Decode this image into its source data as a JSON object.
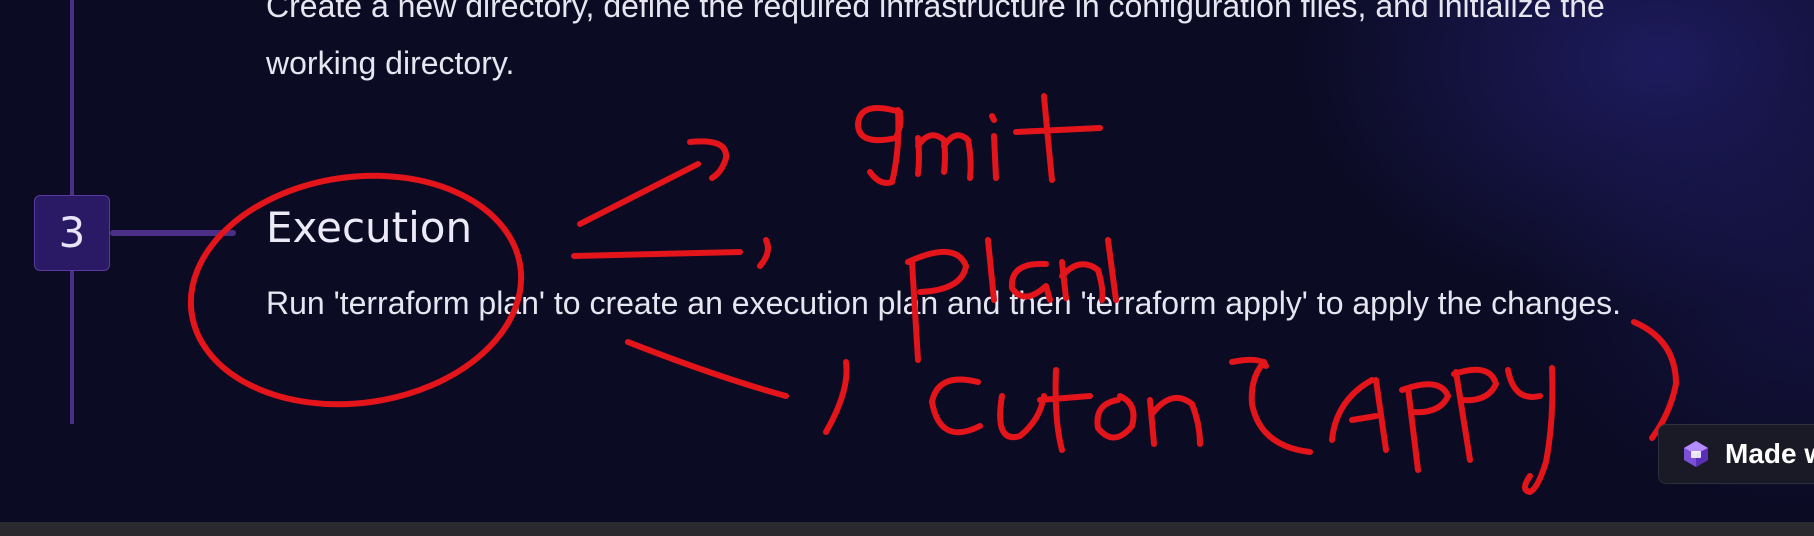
{
  "timeline": {
    "previous_step": {
      "description": "Create a new directory, define the required infrastructure in configuration files, and initialize the working directory."
    },
    "current_step": {
      "number": "3",
      "title": "Execution",
      "description": "Run 'terraform plan' to create an execution plan and then 'terraform apply' to apply the changes."
    }
  },
  "badge": {
    "label": "Made w"
  },
  "colors": {
    "background": "#0b0b24",
    "timeline_accent": "#4b2e86",
    "badge_fill": "#2a1a66",
    "annotation": "#e3141a"
  },
  "icons": {
    "made_with_logo": "gamma-logo-icon"
  }
}
